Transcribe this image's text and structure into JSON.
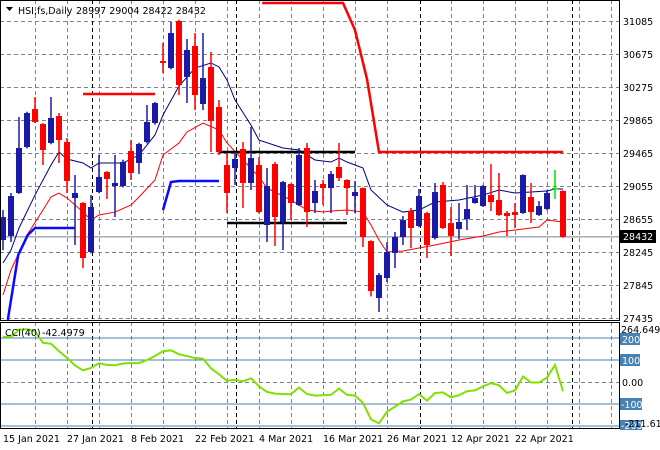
{
  "header": {
    "symbol": "HSI,fs,Daily",
    "ohlc": "28997 29004 28422 28432"
  },
  "price_axis": {
    "labels": [
      "31085",
      "30675",
      "30275",
      "29865",
      "29465",
      "29055",
      "28655",
      "28245",
      "27845",
      "27435"
    ],
    "current_price": "28432"
  },
  "cci": {
    "label": "CCI(40)",
    "value": "-42.4979",
    "axis": {
      "max": "264.6492",
      "min": "-211.6146",
      "l200": "200",
      "l100": "100",
      "l0": "0.00",
      "lm100": "-100",
      "lm200": "-200"
    }
  },
  "time_axis": {
    "labels": [
      "15 Jan 2021",
      "27 Jan 2021",
      "8 Feb 2021",
      "22 Feb 2021",
      "4 Mar 2021",
      "16 Mar 2021",
      "26 Mar 2021",
      "12 Apr 2021",
      "22 Apr 2021"
    ]
  },
  "colors": {
    "bull": "#1a1aa6",
    "bear": "#ff0000",
    "doji": "#00e000",
    "ma_fast": "#000080",
    "ma_slow": "#ff0000",
    "cci": "#80e000",
    "level": "#4682b4"
  },
  "chart_data": {
    "type": "candlestick",
    "title": "HSI,fs,Daily",
    "ylim": [
      27435,
      31085
    ],
    "cci_ylim": [
      -211.6146,
      264.6492
    ],
    "candles": [
      [
        28393,
        28762,
        28270,
        28676
      ],
      [
        28443,
        28971,
        28369,
        28934
      ],
      [
        28971,
        29905,
        28960,
        29524
      ],
      [
        29536,
        29970,
        29520,
        29954
      ],
      [
        30003,
        30151,
        29830,
        29844
      ],
      [
        29819,
        29830,
        29315,
        29500
      ],
      [
        29586,
        30151,
        29570,
        29893
      ],
      [
        29917,
        29954,
        29340,
        29622
      ],
      [
        29598,
        29647,
        28971,
        29119
      ],
      [
        28909,
        29193,
        28332,
        28971
      ],
      [
        28848,
        28860,
        28049,
        28172
      ],
      [
        28246,
        28946,
        28230,
        28799
      ],
      [
        28983,
        29438,
        28970,
        29168
      ],
      [
        29229,
        29240,
        28897,
        29143
      ],
      [
        29057,
        29438,
        28676,
        29094
      ],
      [
        29057,
        29380,
        29040,
        29352
      ],
      [
        29487,
        29622,
        29131,
        29217
      ],
      [
        29340,
        29590,
        29205,
        29573
      ],
      [
        29598,
        30053,
        29580,
        29844
      ],
      [
        29831,
        30090,
        29810,
        30077
      ],
      [
        30593,
        30815,
        30446,
        30569
      ],
      [
        30507,
        31073,
        30490,
        30937
      ],
      [
        31085,
        31100,
        30175,
        30298
      ],
      [
        30397,
        30864,
        30077,
        30729
      ],
      [
        30778,
        30937,
        29991,
        30175
      ],
      [
        30065,
        30937,
        29991,
        30384
      ],
      [
        30520,
        30704,
        29475,
        29856
      ],
      [
        30028,
        30114,
        29438,
        29475
      ],
      [
        29315,
        29463,
        28725,
        28971
      ],
      [
        29278,
        29475,
        29070,
        29389
      ],
      [
        29512,
        29598,
        28787,
        29094
      ],
      [
        29094,
        29782,
        29008,
        29401
      ],
      [
        29315,
        29413,
        28720,
        28737
      ],
      [
        28578,
        29278,
        28369,
        29057
      ],
      [
        29327,
        29352,
        28320,
        28676
      ],
      [
        28615,
        29120,
        28270,
        29106
      ],
      [
        29082,
        29090,
        28639,
        28848
      ],
      [
        28824,
        29524,
        28810,
        29438
      ],
      [
        29524,
        29586,
        28553,
        28737
      ],
      [
        28848,
        29131,
        28725,
        28996
      ],
      [
        29082,
        29131,
        28824,
        29032
      ],
      [
        29032,
        29242,
        28725,
        29205
      ],
      [
        29291,
        29586,
        29119,
        29155
      ],
      [
        29131,
        29140,
        28701,
        29032
      ],
      [
        28934,
        29119,
        28725,
        28983
      ],
      [
        29032,
        29040,
        28307,
        28430
      ],
      [
        28381,
        28390,
        27700,
        27767
      ],
      [
        27681,
        27988,
        27509,
        27963
      ],
      [
        27926,
        28369,
        27877,
        28246
      ],
      [
        28234,
        28492,
        28049,
        28430
      ],
      [
        28430,
        28688,
        28332,
        28639
      ],
      [
        28750,
        28787,
        28295,
        28541
      ],
      [
        28566,
        29020,
        28550,
        28934
      ],
      [
        28725,
        28740,
        28172,
        28332
      ],
      [
        28418,
        29094,
        28400,
        28983
      ],
      [
        29070,
        29106,
        28530,
        28541
      ],
      [
        28602,
        28799,
        28197,
        28443
      ],
      [
        28529,
        28848,
        28406,
        28615
      ],
      [
        28652,
        29070,
        28516,
        28774
      ],
      [
        28848,
        29070,
        28840,
        28909
      ],
      [
        28811,
        29070,
        28800,
        29057
      ],
      [
        28946,
        29327,
        28750,
        28860
      ],
      [
        28885,
        29217,
        28690,
        28701
      ],
      [
        28725,
        28750,
        28443,
        28688
      ],
      [
        28737,
        28848,
        28541,
        28701
      ],
      [
        28725,
        29200,
        28715,
        29193
      ],
      [
        28922,
        29094,
        28602,
        28737
      ],
      [
        28701,
        28873,
        28690,
        28811
      ],
      [
        28774,
        29008,
        28760,
        28971
      ],
      [
        29032,
        29254,
        28897,
        29032
      ],
      [
        28997,
        29004,
        28422,
        28432
      ]
    ],
    "ma_fast": [
      [
        0,
        28111
      ],
      [
        1,
        28270
      ],
      [
        2,
        28541
      ],
      [
        4,
        28946
      ],
      [
        6,
        29315
      ],
      [
        7,
        29475
      ],
      [
        8,
        29389
      ],
      [
        10,
        29340
      ],
      [
        11,
        29278
      ],
      [
        12,
        29340
      ],
      [
        15,
        29340
      ],
      [
        17,
        29438
      ],
      [
        19,
        29684
      ],
      [
        20,
        29930
      ],
      [
        22,
        30286
      ],
      [
        24,
        30507
      ],
      [
        26,
        30569
      ],
      [
        27,
        30520
      ],
      [
        28,
        30360
      ],
      [
        29,
        30114
      ],
      [
        31,
        29806
      ],
      [
        32,
        29622
      ],
      [
        35,
        29524
      ],
      [
        37,
        29500
      ],
      [
        39,
        29377
      ],
      [
        41,
        29352
      ],
      [
        42,
        29401
      ],
      [
        43,
        29352
      ],
      [
        45,
        29278
      ],
      [
        46,
        29008
      ],
      [
        48,
        28824
      ],
      [
        50,
        28737
      ],
      [
        52,
        28762
      ],
      [
        54,
        28860
      ],
      [
        57,
        28885
      ],
      [
        60,
        28946
      ],
      [
        62,
        29008
      ],
      [
        64,
        28971
      ],
      [
        66,
        28983
      ],
      [
        68,
        28996
      ],
      [
        69,
        29020
      ],
      [
        70,
        29020
      ]
    ],
    "ma_slow": [
      [
        0,
        27718
      ],
      [
        1,
        28025
      ],
      [
        3,
        28455
      ],
      [
        5,
        28762
      ],
      [
        6,
        28922
      ],
      [
        7,
        28971
      ],
      [
        8,
        28909
      ],
      [
        10,
        28737
      ],
      [
        11,
        28639
      ],
      [
        12,
        28701
      ],
      [
        14,
        28737
      ],
      [
        16,
        28824
      ],
      [
        17,
        28922
      ],
      [
        19,
        29131
      ],
      [
        20,
        29438
      ],
      [
        22,
        29586
      ],
      [
        23,
        29721
      ],
      [
        25,
        29831
      ],
      [
        27,
        29745
      ],
      [
        28,
        29586
      ],
      [
        30,
        29377
      ],
      [
        32,
        29168
      ],
      [
        33,
        29032
      ],
      [
        36,
        28885
      ],
      [
        38,
        28762
      ],
      [
        40,
        28737
      ],
      [
        41,
        28750
      ],
      [
        43,
        28762
      ],
      [
        45,
        28737
      ],
      [
        46,
        28578
      ],
      [
        47,
        28393
      ],
      [
        48,
        28246
      ],
      [
        50,
        28258
      ],
      [
        52,
        28295
      ],
      [
        54,
        28332
      ],
      [
        57,
        28393
      ],
      [
        60,
        28443
      ],
      [
        62,
        28492
      ],
      [
        64,
        28516
      ],
      [
        67,
        28553
      ],
      [
        68,
        28639
      ],
      [
        70,
        28615
      ]
    ],
    "upper_band": [
      [
        [
          10,
          30188
        ],
        [
          19,
          30188
        ]
      ],
      [
        [
          32.4,
          31306
        ],
        [
          42.5,
          31306
        ],
        [
          44,
          30974
        ],
        [
          45.5,
          30372
        ],
        [
          47,
          29475
        ],
        [
          70,
          29475
        ]
      ]
    ],
    "lower_band": [
      [
        [
          0.6,
          27411
        ],
        [
          1.9,
          28209
        ],
        [
          3.1,
          28455
        ],
        [
          4,
          28541
        ],
        [
          9,
          28541
        ]
      ],
      [
        [
          20,
          28762
        ],
        [
          21,
          29106
        ],
        [
          22,
          29119
        ],
        [
          27,
          29119
        ]
      ]
    ],
    "range_lines": [
      [
        27,
        44,
        29475
      ],
      [
        28,
        43,
        28602
      ]
    ],
    "cci_values": [
      205,
      205,
      238,
      240,
      230,
      178,
      174,
      140,
      110,
      75,
      53,
      64,
      85,
      78,
      76,
      84,
      86,
      86,
      100,
      118,
      140,
      144,
      126,
      118,
      109,
      106,
      62,
      35,
      5,
      10,
      3,
      17,
      -20,
      -45,
      -53,
      -55,
      -55,
      -25,
      -55,
      -62,
      -60,
      -58,
      -30,
      -58,
      -62,
      -95,
      -170,
      -188,
      -135,
      -112,
      -88,
      -80,
      -55,
      -85,
      -50,
      -47,
      -70,
      -60,
      -42,
      -38,
      -20,
      -5,
      -15,
      -50,
      -38,
      25,
      -2,
      -2,
      20,
      78,
      -42.4979
    ]
  }
}
